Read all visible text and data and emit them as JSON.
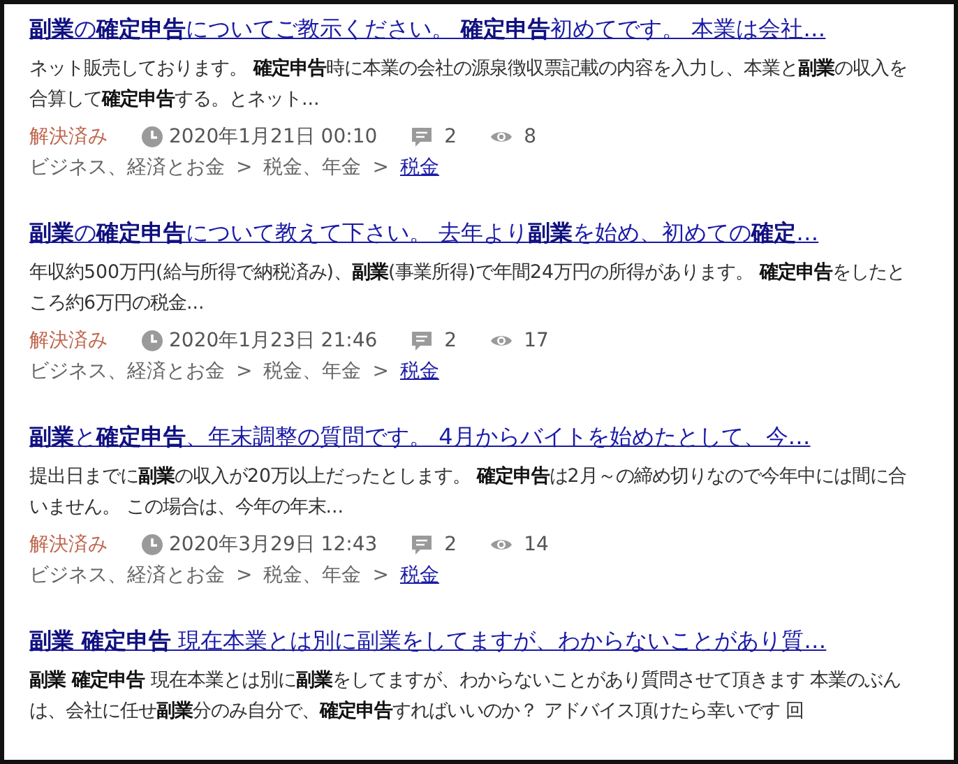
{
  "results": [
    {
      "title": "**副業**の**確定申告**についてご教示ください。 **確定申告**初めてです。 本業は会社…",
      "snippet": "ネット販売しております。 **確定申告**時に本業の会社の源泉徴収票記載の内容を入力し、本業と**副業**の収入を合算して**確定申告**する。とネット...",
      "status": "解決済み",
      "date": "2020年1月21日 00:10",
      "answers": "2",
      "views": "8",
      "breadcrumb": [
        {
          "kind": "crumb",
          "label": "ビジネス、経済とお金"
        },
        {
          "kind": "sep",
          "label": ">"
        },
        {
          "kind": "crumb",
          "label": "税金、年金"
        },
        {
          "kind": "sep",
          "label": ">"
        },
        {
          "kind": "link",
          "label": "税金"
        }
      ]
    },
    {
      "title": "**副業**の**確定申告**について教えて下さい。 去年より**副業**を始め、初めての**確定**…",
      "snippet": "年収約500万円(給与所得で納税済み)、**副業**(事業所得)で年間24万円の所得があります。 **確定申告**をしたところ約6万円の税金...",
      "status": "解決済み",
      "date": "2020年1月23日 21:46",
      "answers": "2",
      "views": "17",
      "breadcrumb": [
        {
          "kind": "crumb",
          "label": "ビジネス、経済とお金"
        },
        {
          "kind": "sep",
          "label": ">"
        },
        {
          "kind": "crumb",
          "label": "税金、年金"
        },
        {
          "kind": "sep",
          "label": ">"
        },
        {
          "kind": "link",
          "label": "税金"
        }
      ]
    },
    {
      "title": "**副業**と**確定申告**、年末調整の質問です。 4月からバイトを始めたとして、今…",
      "snippet": "提出日までに**副業**の収入が20万以上だったとします。 **確定申告**は2月～の締め切りなので今年中には間に合いません。 この場合は、今年の年末...",
      "status": "解決済み",
      "date": "2020年3月29日 12:43",
      "answers": "2",
      "views": "14",
      "breadcrumb": [
        {
          "kind": "crumb",
          "label": "ビジネス、経済とお金"
        },
        {
          "kind": "sep",
          "label": ">"
        },
        {
          "kind": "crumb",
          "label": "税金、年金"
        },
        {
          "kind": "sep",
          "label": ">"
        },
        {
          "kind": "link",
          "label": "税金"
        }
      ]
    },
    {
      "title": "**副業 確定申告** 現在本業とは別に副業をしてますが、わからないことがあり質…",
      "snippet": "**副業 確定申告** 現在本業とは別に**副業**をしてますが、わからないことがあり質問させて頂きます 本業のぶんは、会社に任せ**副業**分のみ自分で、**確定申告**すればいいのか？ アドバイス頂けたら幸いです 回"
    }
  ]
}
